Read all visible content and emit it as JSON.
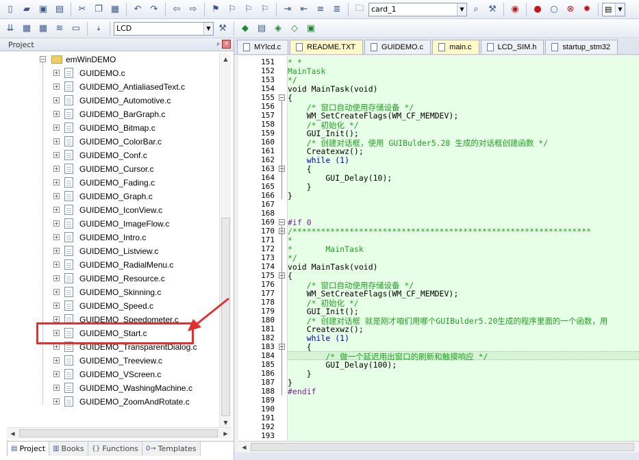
{
  "toolbar1": {
    "target_combo": "card_1"
  },
  "toolbar2": {
    "target_combo": "LCD"
  },
  "project_panel": {
    "title": "Project",
    "pin_glyph": "ᵖ",
    "close_glyph": "×",
    "folder": "emWinDEMO",
    "files": [
      "GUIDEMO.c",
      "GUIDEMO_AntialiasedText.c",
      "GUIDEMO_Automotive.c",
      "GUIDEMO_BarGraph.c",
      "GUIDEMO_Bitmap.c",
      "GUIDEMO_ColorBar.c",
      "GUIDEMO_Conf.c",
      "GUIDEMO_Cursor.c",
      "GUIDEMO_Fading.c",
      "GUIDEMO_Graph.c",
      "GUIDEMO_IconView.c",
      "GUIDEMO_ImageFlow.c",
      "GUIDEMO_Intro.c",
      "GUIDEMO_Listview.c",
      "GUIDEMO_RadialMenu.c",
      "GUIDEMO_Resource.c",
      "GUIDEMO_Skinning.c",
      "GUIDEMO_Speed.c",
      "GUIDEMO_Speedometer.c",
      "GUIDEMO_Start.c",
      "GUIDEMO_TransparentDialog.c",
      "GUIDEMO_Treeview.c",
      "GUIDEMO_VScreen.c",
      "GUIDEMO_WashingMachine.c",
      "GUIDEMO_ZoomAndRotate.c"
    ],
    "highlighted_file": "GUIDEMO_Start.c"
  },
  "bottom_tabs": [
    {
      "label": "Project",
      "icon": "project-icon",
      "active": true
    },
    {
      "label": "Books",
      "icon": "books-icon",
      "active": false
    },
    {
      "label": "Functions",
      "icon": "functions-icon",
      "active": false
    },
    {
      "label": "Templates",
      "icon": "templates-icon",
      "active": false
    }
  ],
  "editor_tabs": [
    {
      "label": "MYlcd.c",
      "active": false
    },
    {
      "label": "README.TXT",
      "active": true
    },
    {
      "label": "GUIDEMO.c",
      "active": false
    },
    {
      "label": "main.c",
      "active": true
    },
    {
      "label": "LCD_SIM.h",
      "active": false
    },
    {
      "label": "startup_stm32",
      "active": false
    }
  ],
  "code": {
    "first_line": 151,
    "lines": [
      {
        "t": "* *",
        "c": "cmt"
      },
      {
        "t": "MainTask",
        "c": "cmt"
      },
      {
        "t": "*/",
        "c": "cmt"
      },
      {
        "t": "void MainTask(void)",
        "c": "code"
      },
      {
        "t": "{",
        "c": "code"
      },
      {
        "t": "    /* 窗口自动使用存储设备 */",
        "c": "cmt"
      },
      {
        "t": "    WM_SetCreateFlags(WM_CF_MEMDEV);",
        "c": "code"
      },
      {
        "t": "    /* 初始化 */",
        "c": "cmt"
      },
      {
        "t": "    GUI_Init();",
        "c": "code"
      },
      {
        "t": "    /* 创建对话框，使用 GUIBulder5.28 生成的对话框创建函数 */",
        "c": "cmt"
      },
      {
        "t": "    Createxwz();",
        "c": "code"
      },
      {
        "t": "    while (1)",
        "c": "kw"
      },
      {
        "t": "    {",
        "c": "code"
      },
      {
        "t": "        GUI_Delay(10);",
        "c": "code"
      },
      {
        "t": "    }",
        "c": "code"
      },
      {
        "t": "}",
        "c": "code"
      },
      {
        "t": "",
        "c": "code"
      },
      {
        "t": "",
        "c": "code"
      },
      {
        "t": "#if 0",
        "c": "pre"
      },
      {
        "t": "/***************************************************************",
        "c": "cmt"
      },
      {
        "t": "*",
        "c": "cmt"
      },
      {
        "t": "*       MainTask",
        "c": "cmt"
      },
      {
        "t": "*/",
        "c": "cmt"
      },
      {
        "t": "void MainTask(void)",
        "c": "code"
      },
      {
        "t": "{",
        "c": "code"
      },
      {
        "t": "    /* 窗口自动使用存储设备 */",
        "c": "cmt"
      },
      {
        "t": "    WM_SetCreateFlags(WM_CF_MEMDEV);",
        "c": "code"
      },
      {
        "t": "    /* 初始化 */",
        "c": "cmt"
      },
      {
        "t": "    GUI_Init();",
        "c": "code"
      },
      {
        "t": "    /* 创建对话框 就是刚才咱们用哪个GUIBulder5.20生成的程序里面的一个函数，用",
        "c": "cmt"
      },
      {
        "t": "    Createxwz();",
        "c": "code"
      },
      {
        "t": "    while (1)",
        "c": "kw"
      },
      {
        "t": "    {",
        "c": "code"
      },
      {
        "t": "        /* 做一个延迟用出窗口的刷新和触摸响应 */",
        "c": "cmt"
      },
      {
        "t": "        GUI_Delay(100);",
        "c": "code"
      },
      {
        "t": "    }",
        "c": "code"
      },
      {
        "t": "}",
        "c": "code"
      },
      {
        "t": "#endif",
        "c": "pre"
      },
      {
        "t": "",
        "c": "code"
      },
      {
        "t": "",
        "c": "code"
      },
      {
        "t": "",
        "c": "code"
      },
      {
        "t": "",
        "c": "code"
      },
      {
        "t": "",
        "c": "code"
      }
    ]
  },
  "colors": {
    "code_background": "#e6ffe6",
    "comment": "#20a020",
    "keyword": "#0000c8",
    "annotation": "#e03030"
  }
}
